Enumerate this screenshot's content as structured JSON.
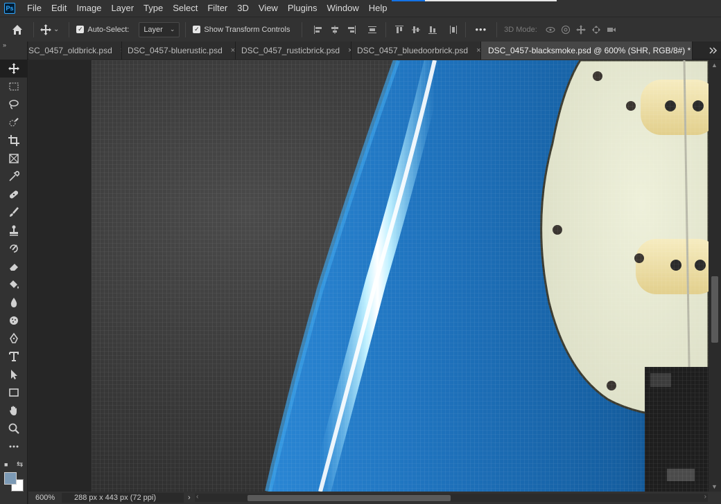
{
  "app": {
    "logo_text": "Ps"
  },
  "menu": [
    "File",
    "Edit",
    "Image",
    "Layer",
    "Type",
    "Select",
    "Filter",
    "3D",
    "View",
    "Plugins",
    "Window",
    "Help"
  ],
  "options": {
    "auto_select_label": "Auto-Select:",
    "auto_select_checked": true,
    "layer_select_value": "Layer",
    "show_transform_label": "Show Transform Controls",
    "show_transform_checked": true,
    "more_label": "•••",
    "mode_3d_label": "3D Mode:"
  },
  "tabs": [
    {
      "label": "SC_0457_oldbrick.psd",
      "active": false
    },
    {
      "label": "DSC_0457-bluerustic.psd",
      "active": false
    },
    {
      "label": "DSC_0457_rusticbrick.psd",
      "active": false
    },
    {
      "label": "DSC_0457_bluedoorbrick.psd",
      "active": false
    },
    {
      "label": "DSC_0457-blacksmoke.psd @ 600% (SHR, RGB/8#) *",
      "active": true
    }
  ],
  "tab_close_glyph": "×",
  "toolbar": {
    "collapse_glyph": "»",
    "tools": [
      "move-tool",
      "marquee-tool",
      "lasso-tool",
      "quick-select-tool",
      "crop-tool",
      "frame-tool",
      "eyedropper-tool",
      "healing-brush-tool",
      "brush-tool",
      "clone-stamp-tool",
      "history-brush-tool",
      "eraser-tool",
      "paint-bucket-tool",
      "blur-tool",
      "sponge-tool",
      "pen-tool",
      "type-tool",
      "path-selection-tool",
      "rectangle-tool",
      "hand-tool",
      "zoom-tool",
      "more-tools"
    ],
    "foreground_color": "#7c9ab5",
    "background_color": "#ffffff"
  },
  "status": {
    "zoom": "600%",
    "doc_info": "288 px x 443 px (72 ppi)",
    "arrow": "›"
  },
  "colors": {
    "accent": "#1473e6",
    "guitar_blue": "#1e79c4",
    "pickguard": "#e7ead2",
    "background_gray": "#333333"
  }
}
